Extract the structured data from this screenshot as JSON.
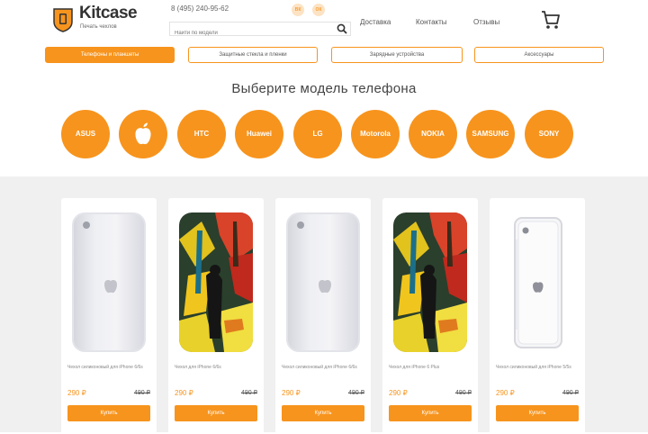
{
  "header": {
    "logo_text": "Kitcase",
    "logo_tagline": "Печать чехлов",
    "phone": "8 (495) 240-95-62",
    "social": [
      "vk",
      "ok"
    ],
    "search_placeholder": "Найти по модели",
    "nav": [
      "Доставка",
      "Контакты",
      "Отзывы"
    ]
  },
  "tabs": [
    {
      "label": "Телефоны и планшеты",
      "active": true
    },
    {
      "label": "Защитные стекла и пленки",
      "active": false
    },
    {
      "label": "Зарядные устройства",
      "active": false
    },
    {
      "label": "Аксессуары",
      "active": false
    }
  ],
  "brands": {
    "title": "Выберите модель телефона",
    "items": [
      "ASUS",
      "Apple",
      "HTC",
      "Huawei",
      "LG",
      "Motorola",
      "NOKIA",
      "SAMSUNG",
      "SONY"
    ]
  },
  "products": [
    {
      "name": "Чехол силиконовый для iPhone 6/6s",
      "price": "290 ₽",
      "old_price": "490 ₽",
      "button": "Купить",
      "image": "clear-case"
    },
    {
      "name": "Чехол для iPhone 6/6s",
      "price": "290 ₽",
      "old_price": "490 ₽",
      "button": "Купить",
      "image": "art-case"
    },
    {
      "name": "Чехол силиконовый для iPhone 6/6s",
      "price": "290 ₽",
      "old_price": "490 ₽",
      "button": "Купить",
      "image": "clear-case"
    },
    {
      "name": "Чехол для iPhone 6 Plus",
      "price": "290 ₽",
      "old_price": "490 ₽",
      "button": "Купить",
      "image": "art-case"
    },
    {
      "name": "Чехол силиконовый для iPhone 5/5s",
      "price": "290 ₽",
      "old_price": "490 ₽",
      "button": "Купить",
      "image": "clear-case-5"
    }
  ],
  "colors": {
    "accent": "#f7941d",
    "section_bg": "#f0f0f0"
  }
}
